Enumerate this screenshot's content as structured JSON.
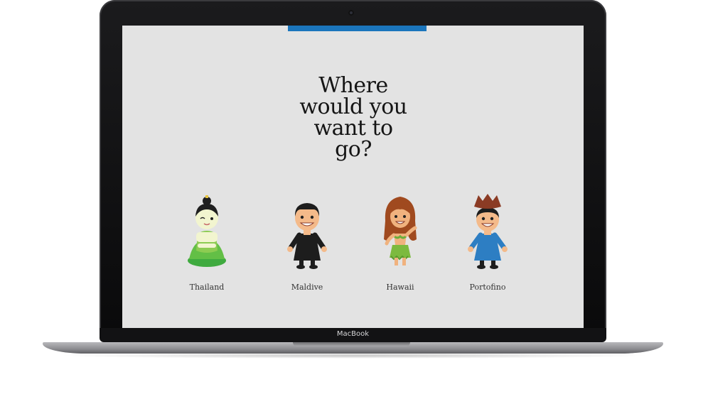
{
  "device": {
    "brand_label": "MacBook"
  },
  "page": {
    "heading_lines": [
      "Where",
      "would you",
      "want to",
      "go?"
    ],
    "accent_color": "#1b75bc",
    "background_color": "#e3e3e3"
  },
  "destinations": [
    {
      "label": "Thailand",
      "icon": "thai-dancer-character"
    },
    {
      "label": "Maldive",
      "icon": "man-in-black-robe-character"
    },
    {
      "label": "Hawaii",
      "icon": "hula-girl-character"
    },
    {
      "label": "Portofino",
      "icon": "man-in-blue-coat-and-hat-character"
    }
  ]
}
